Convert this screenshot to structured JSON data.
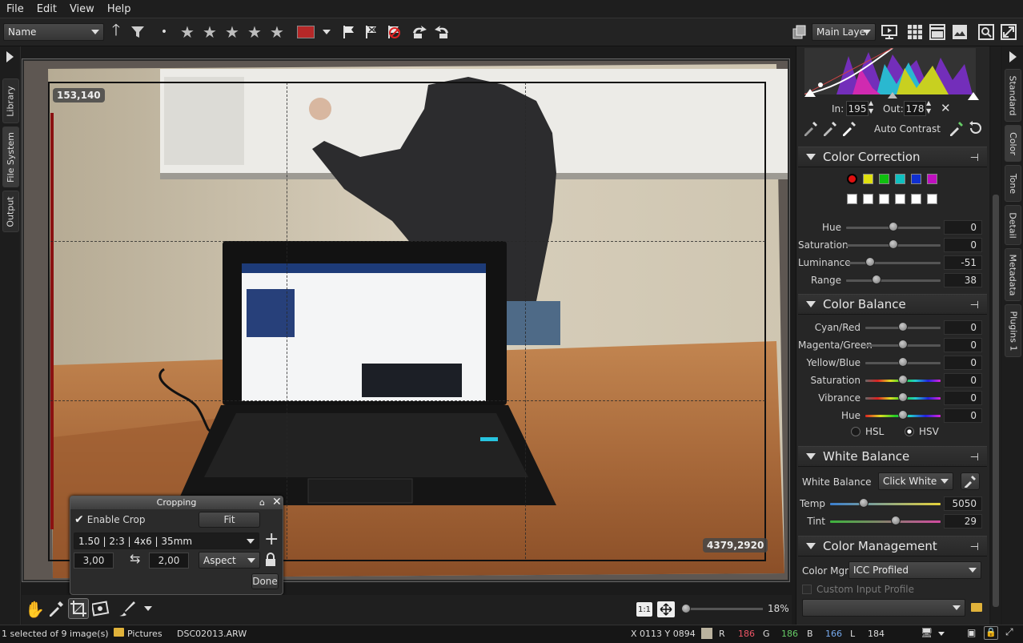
{
  "menu": [
    "File",
    "Edit",
    "View",
    "Help"
  ],
  "toolbar": {
    "sort_by": "Name",
    "layer": "Main Layer",
    "label_color": "#b52828"
  },
  "left_tabs": [
    "Library",
    "File System",
    "Output"
  ],
  "right_tabs": [
    "Standard",
    "Color",
    "Tone",
    "Detail",
    "Metadata",
    "Plugins 1"
  ],
  "viewer": {
    "top_left_coord": "153,140",
    "bottom_right_coord": "4379,2920"
  },
  "cropping": {
    "title": "Cropping",
    "enable_label": "Enable Crop",
    "enabled": true,
    "fit_label": "Fit",
    "preset": "1.50 | 2:3 | 4x6 | 35mm",
    "width": "3,00",
    "height": "2,00",
    "mode": "Aspect",
    "done_label": "Done"
  },
  "zoom": {
    "one_to_one": "1:1",
    "percent": "18%",
    "level": 0
  },
  "status": {
    "selection": "1 selected of 9 image(s)",
    "folder": "Pictures",
    "filename": "DSC02013.ARW",
    "coords": "X 0113  Y 0894",
    "r_label": "R",
    "r": "186",
    "g_label": "G",
    "g": "186",
    "b_label": "B",
    "b": "166",
    "l_label": "L",
    "l": "184"
  },
  "curve": {
    "in_label": "In:",
    "in_value": "195",
    "out_label": "Out:",
    "out_value": "178",
    "auto_contrast": "Auto Contrast"
  },
  "color_correction": {
    "title": "Color Correction",
    "swatches": [
      "#e01010",
      "#e0e010",
      "#10c010",
      "#10c0c0",
      "#1030d0",
      "#c010c0"
    ],
    "sliders": [
      {
        "label": "Hue",
        "value": "0",
        "level": 0.5
      },
      {
        "label": "Saturation",
        "value": "0",
        "level": 0.5
      },
      {
        "label": "Luminance",
        "value": "-51",
        "level": 0.25
      },
      {
        "label": "Range",
        "value": "38",
        "level": 0.32
      }
    ]
  },
  "color_balance": {
    "title": "Color Balance",
    "sliders": [
      {
        "label": "Cyan/Red",
        "value": "0",
        "level": 0.5
      },
      {
        "label": "Magenta/Green",
        "value": "0",
        "level": 0.5
      },
      {
        "label": "Yellow/Blue",
        "value": "0",
        "level": 0.5
      },
      {
        "label": "Saturation",
        "value": "0",
        "level": 0.5
      },
      {
        "label": "Vibrance",
        "value": "0",
        "level": 0.5
      },
      {
        "label": "Hue",
        "value": "0",
        "level": 0.5
      }
    ],
    "hsl_label": "HSL",
    "hsv_label": "HSV",
    "selected": "HSV"
  },
  "white_balance": {
    "title": "White Balance",
    "label": "White Balance",
    "mode": "Click White",
    "temp_label": "Temp",
    "temp_value": "5050",
    "tint_label": "Tint",
    "tint_value": "29"
  },
  "color_management": {
    "title": "Color Management",
    "label": "Color Mgmt",
    "profile": "ICC Profiled",
    "custom_label": "Custom Input Profile"
  }
}
